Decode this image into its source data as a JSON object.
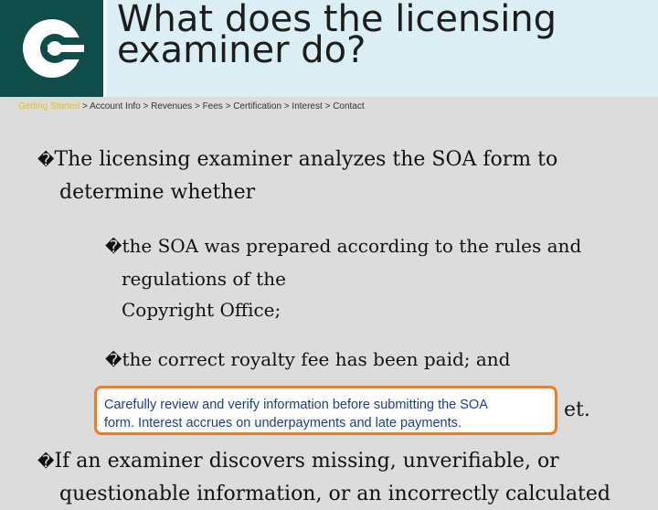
{
  "header": {
    "logo_icon": "copyright-c-logo",
    "title_line1": "What does the licensing",
    "title_line2": "examiner do?",
    "colors": {
      "logo_bg": "#0f4d4a",
      "header_bg": "#dbeef4"
    }
  },
  "breadcrumb": {
    "items": [
      "Getting Started",
      "Account Info",
      "Revenues",
      "Fees",
      "Certification",
      "Interest",
      "Contact"
    ],
    "separator": ">",
    "active_color": "#e0c020"
  },
  "content": {
    "bullet_glyph": "�",
    "p1_line1": "The licensing examiner analyzes the SOA form to",
    "p1_line2": "determine whether",
    "b1_line1": "the SOA was prepared according to the rules and",
    "b1_line2": "regulations of the",
    "b1_line3": "Copyright Office;",
    "b2_line1": "the correct royalty fee has been paid; and",
    "b3_tail": "et.",
    "p2_line1": "If an examiner discovers missing, unverifiable, or",
    "p2_line2": "questionable information, or an incorrectly calculated"
  },
  "tooltip": {
    "line1": "Carefully review and verify information before submitting the SOA",
    "line2": "form. Interest accrues on underpayments and late payments.",
    "border_color": "#ec7c25"
  }
}
